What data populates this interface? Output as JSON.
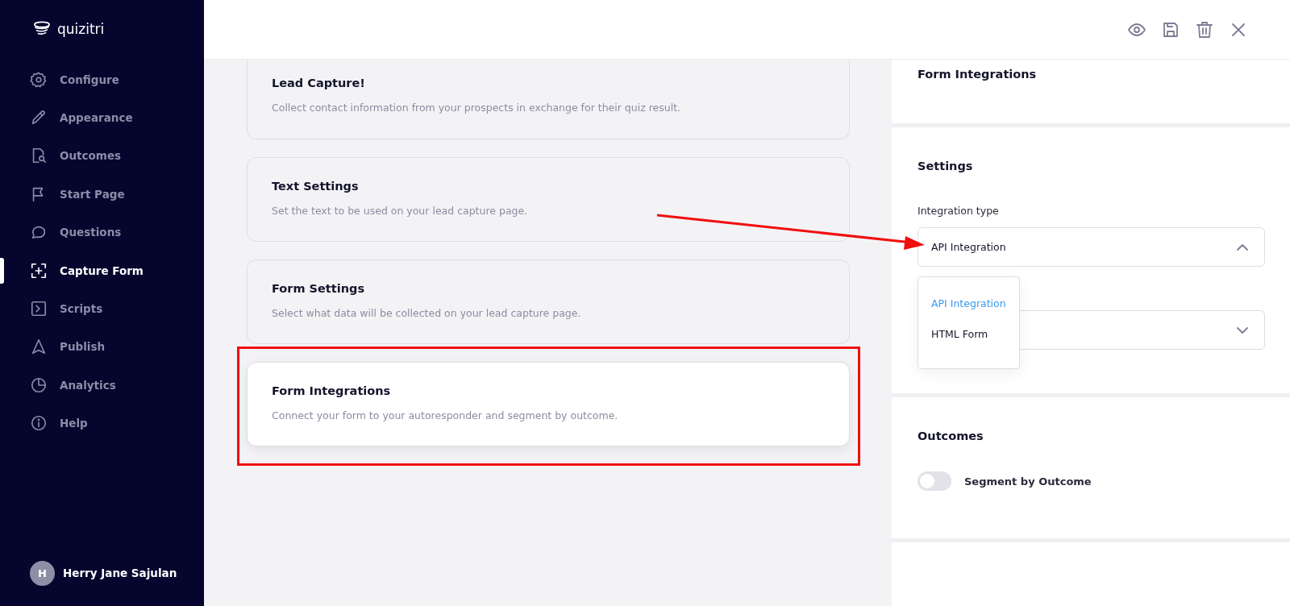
{
  "logo": {
    "text": "quizitri"
  },
  "sidebar": {
    "items": [
      {
        "label": "Configure",
        "selected": false
      },
      {
        "label": "Appearance",
        "selected": false
      },
      {
        "label": "Outcomes",
        "selected": false
      },
      {
        "label": "Start Page",
        "selected": false
      },
      {
        "label": "Questions",
        "selected": false
      },
      {
        "label": "Capture Form",
        "selected": true
      },
      {
        "label": "Scripts",
        "selected": false
      },
      {
        "label": "Publish",
        "selected": false
      },
      {
        "label": "Analytics",
        "selected": false
      },
      {
        "label": "Help",
        "selected": false
      }
    ],
    "user": {
      "initial": "H",
      "name": "Herry Jane Sajulan"
    }
  },
  "cards": [
    {
      "title": "Lead Capture!",
      "description": "Collect contact information from your prospects in exchange for their quiz result.",
      "selected": false,
      "annotated": false
    },
    {
      "title": "Text Settings",
      "description": "Set the text to be used on your lead capture page.",
      "selected": false,
      "annotated": false
    },
    {
      "title": "Form Settings",
      "description": "Select what data will be collected on your lead capture page.",
      "selected": false,
      "annotated": false
    },
    {
      "title": "Form Integrations",
      "description": "Connect your form to your autoresponder and segment by outcome.",
      "selected": true,
      "annotated": true
    }
  ],
  "panel": {
    "header": "Form Integrations",
    "settings": {
      "title": "Settings",
      "integration_type": {
        "label": "Integration type",
        "value": "API Integration",
        "expanded": true,
        "options": [
          {
            "label": "API Integration",
            "selected": true
          },
          {
            "label": "HTML Form",
            "selected": false
          }
        ]
      }
    },
    "outcomes": {
      "title": "Outcomes",
      "toggle": {
        "label": "Segment by Outcome",
        "on": false
      }
    }
  }
}
